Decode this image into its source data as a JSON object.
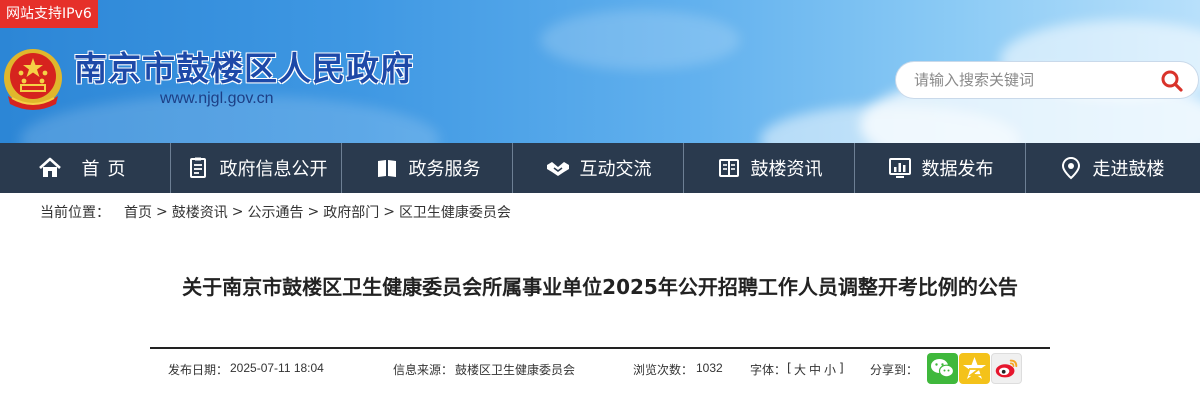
{
  "header": {
    "ipv6_badge": "网站支持IPv6",
    "site_title": "南京市鼓楼区人民政府",
    "site_url": "www.njgl.gov.cn",
    "search": {
      "placeholder": "请输入搜索关键词",
      "value": ""
    }
  },
  "nav": {
    "items": [
      {
        "label": "首页",
        "icon": "home-icon"
      },
      {
        "label": "政府信息公开",
        "icon": "document-icon"
      },
      {
        "label": "政务服务",
        "icon": "book-icon"
      },
      {
        "label": "互动交流",
        "icon": "handshake-icon"
      },
      {
        "label": "鼓楼资讯",
        "icon": "news-book-icon"
      },
      {
        "label": "数据发布",
        "icon": "chart-screen-icon"
      },
      {
        "label": "走进鼓楼",
        "icon": "location-pin-icon"
      }
    ]
  },
  "breadcrumb": {
    "label": "当前位置：",
    "separator": ">",
    "items": [
      "首页",
      "鼓楼资讯",
      "公示通告",
      "政府部门",
      "区卫生健康委员会"
    ]
  },
  "article": {
    "title": "关于南京市鼓楼区卫生健康委员会所属事业单位2025年公开招聘工作人员调整开考比例的公告",
    "meta": {
      "date_label": "发布日期：",
      "date": "2025-07-11 18:04",
      "source_label": "信息来源：",
      "source": "鼓楼区卫生健康委员会",
      "views_label": "浏览次数：",
      "views": "1032",
      "font_label": "字体：",
      "font_open": "[",
      "font_large": "大",
      "font_medium": "中",
      "font_small": "小",
      "font_close": "]",
      "share_label": "分享到："
    },
    "share": [
      "wechat-icon",
      "qzone-icon",
      "weibo-icon"
    ]
  },
  "colors": {
    "nav_bg": "#2a3a4e",
    "title_blue": "#1d49a8",
    "badge_red": "#e6302a"
  }
}
